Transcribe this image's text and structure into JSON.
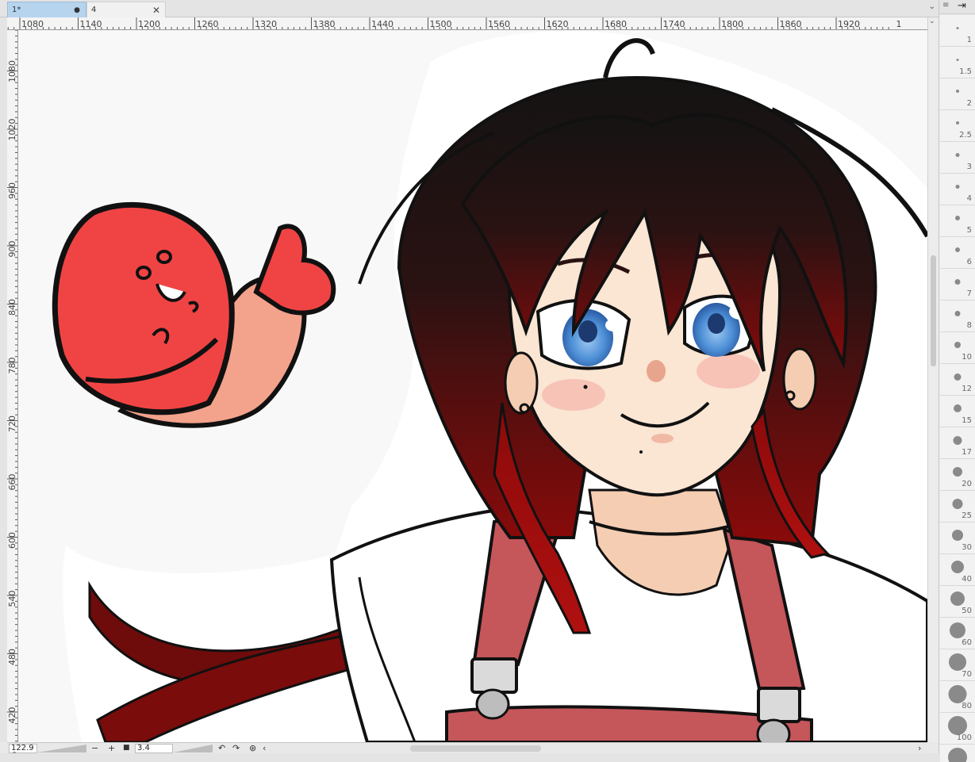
{
  "tabs": [
    {
      "label": "1*",
      "active": true,
      "modified": true
    },
    {
      "label": "4",
      "active": false
    }
  ],
  "ruler": {
    "horizontal_ticks": [
      "1080",
      "1140",
      "1200",
      "1260",
      "1320",
      "1380",
      "1440",
      "1500",
      "1560",
      "1620",
      "1680",
      "1740",
      "1800",
      "1860",
      "1920",
      "1"
    ],
    "vertical_ticks": [
      "1080",
      "1020",
      "960",
      "900",
      "840",
      "780",
      "720",
      "660",
      "600",
      "540",
      "480",
      "420"
    ]
  },
  "status": {
    "zoom": "122.9",
    "rotation": "3.4"
  },
  "brush_sizes": [
    "1",
    "1.5",
    "2",
    "2.5",
    "3",
    "4",
    "5",
    "6",
    "7",
    "8",
    "10",
    "12",
    "15",
    "17",
    "20",
    "25",
    "30",
    "40",
    "50",
    "60",
    "70",
    "80",
    "100",
    ""
  ],
  "icons": {
    "tab_menu": "chevron-down-icon",
    "panel_menu": "menu-icon",
    "panel_exit": "exit-icon"
  },
  "colors": {
    "active_tab": "#b7d4ef",
    "canvas": "#f8f8f8",
    "hair_dark": "#151313",
    "hair_red": "#8b0a0a",
    "eyes": "#4d8fd6",
    "skin": "#fbe5d3",
    "overalls": "#c5565a",
    "fish": "#f04444"
  }
}
